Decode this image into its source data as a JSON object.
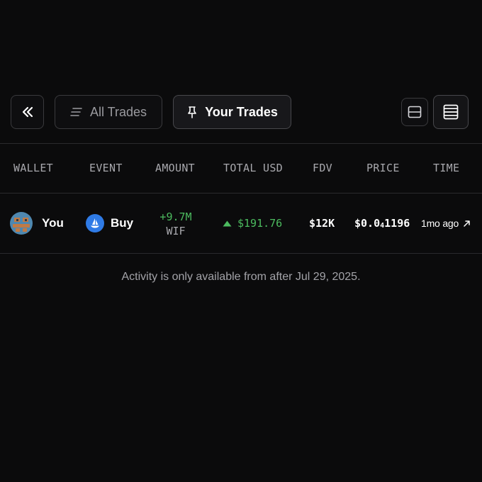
{
  "toolbar": {
    "all_trades_label": "All Trades",
    "your_trades_label": "Your Trades"
  },
  "table": {
    "headers": [
      "WALLET",
      "EVENT",
      "AMOUNT",
      "TOTAL USD",
      "FDV",
      "PRICE",
      "TIME"
    ],
    "rows": [
      {
        "wallet": "You",
        "event": "Buy",
        "amount": "+9.7M",
        "token": "WIF",
        "total_usd": "$191.76",
        "fdv": "$12K",
        "price_prefix": "$0.0",
        "price_zeros": "4",
        "price_digits": "1196",
        "time": "1mo ago"
      }
    ]
  },
  "note": "Activity is only available from after Jul 29, 2025.",
  "colors": {
    "positive": "#4cbb5f",
    "event_icon": "#2f7be6",
    "background": "#0b0b0c"
  }
}
